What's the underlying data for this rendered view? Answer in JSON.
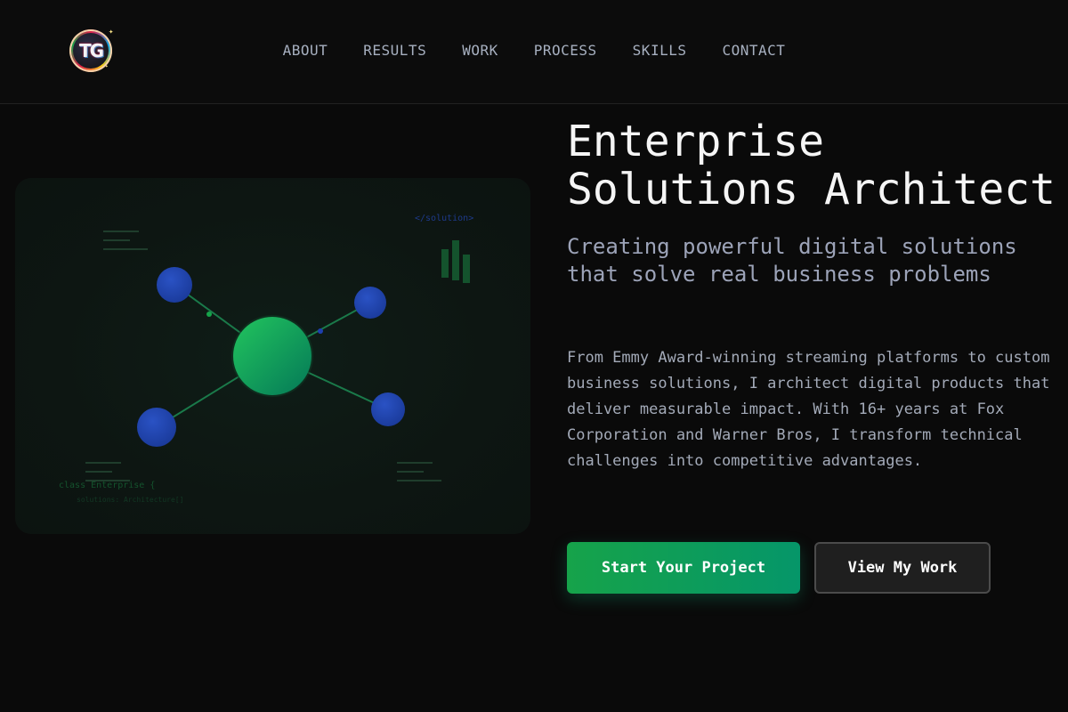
{
  "header": {
    "logo_text": "TG",
    "nav": [
      {
        "label": "ABOUT"
      },
      {
        "label": "RESULTS"
      },
      {
        "label": "WORK"
      },
      {
        "label": "PROCESS"
      },
      {
        "label": "SKILLS"
      },
      {
        "label": "CONTACT"
      }
    ]
  },
  "hero": {
    "title_line1": "Enterprise",
    "title_line2": "Solutions Architect",
    "subtitle": "Creating powerful digital solutions that solve real business problems",
    "description": "From Emmy Award-winning streaming platforms to custom business solutions, I architect digital products that deliver measurable impact. With 16+ years at Fox Corporation and Warner Bros, I transform technical challenges into competitive advantages.",
    "primary_button": "Start Your Project",
    "secondary_button": "View My Work",
    "illustration": {
      "code_tag": "</solution>",
      "code_class": "class Enterprise {",
      "code_sub": "solutions: Architecture[]"
    }
  },
  "colors": {
    "background": "#0a0a0a",
    "accent_green": "#16a34a",
    "accent_teal": "#059669",
    "node_blue": "#1e40af",
    "text_muted": "#9ca3b8"
  }
}
